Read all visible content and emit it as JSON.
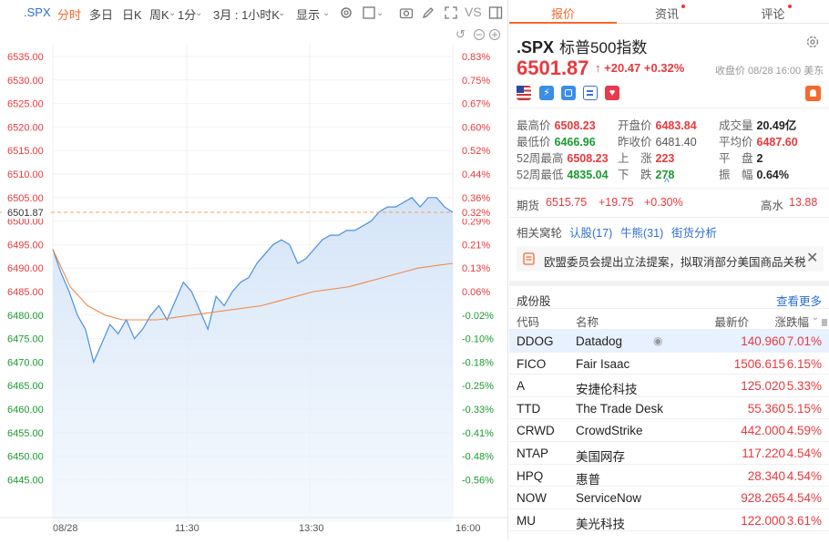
{
  "toolbar": {
    "ticker": ".SPX",
    "timeshare": "分时",
    "multiday": "多日",
    "dayk": "日K",
    "weekk": "周K",
    "minute": "1分",
    "period": "3月 : 1小时K",
    "display": "显示",
    "vs": "VS"
  },
  "chart_data": {
    "type": "line",
    "x_labels": [
      "08/28",
      "11:30",
      "13:30",
      "16:00"
    ],
    "y_left_ticks": [
      "6535.00",
      "6530.00",
      "6525.00",
      "6520.00",
      "6515.00",
      "6510.00",
      "6505.00",
      "6500.00",
      "6495.00",
      "6490.00",
      "6485.00",
      "6480.00",
      "6475.00",
      "6470.00",
      "6465.00",
      "6460.00",
      "6455.00",
      "6450.00",
      "6445.00"
    ],
    "y_right_ticks": [
      "0.83%",
      "0.75%",
      "0.67%",
      "0.60%",
      "0.52%",
      "0.44%",
      "0.36%",
      "0.29%",
      "0.21%",
      "0.13%",
      "0.06%",
      "-0.02%",
      "-0.10%",
      "-0.18%",
      "-0.25%",
      "-0.33%",
      "-0.41%",
      "-0.48%",
      "-0.56%"
    ],
    "ylim": [
      6445,
      6535
    ],
    "current_label_left": "6501.87",
    "current_label_right": "0.32%",
    "current_value": 6501.87,
    "price_series": [
      6494,
      6489,
      6485,
      6480,
      6477,
      6470,
      6474,
      6478,
      6476,
      6479,
      6475,
      6477,
      6480,
      6482,
      6479,
      6483,
      6487,
      6485,
      6481,
      6477,
      6484,
      6482,
      6485,
      6487,
      6488,
      6491,
      6493,
      6495,
      6496,
      6495,
      6491,
      6492,
      6494,
      6496,
      6497,
      6497,
      6498,
      6498,
      6499,
      6500,
      6502,
      6503,
      6503,
      6504,
      6505,
      6503,
      6505,
      6505,
      6503,
      6501.87
    ],
    "avg_series": [
      6494,
      6486,
      6482,
      6480,
      6479,
      6479,
      6479,
      6479.5,
      6480,
      6480.5,
      6481,
      6481.5,
      6482,
      6483,
      6484,
      6485,
      6485.5,
      6486,
      6487,
      6488,
      6489,
      6490,
      6490.5,
      6491
    ],
    "colors": {
      "price": "#4a90e2",
      "avg": "#f08b4a",
      "ref": "#f5a05a",
      "up": "#e8393d",
      "down": "#1a9b2e"
    }
  },
  "right": {
    "tabs": [
      "报价",
      "资讯",
      "评论"
    ],
    "symbol": ".SPX",
    "name": "标普500指数",
    "price": "6501.87",
    "change": "+20.47",
    "change_pct": "+0.32%",
    "close_time": "收盘价 08/28 16:00 美东",
    "stats": {
      "high_k": "最高价",
      "high_v": "6508.23",
      "open_k": "开盘价",
      "open_v": "6483.84",
      "vol_k": "成交量",
      "vol_v": "20.49亿",
      "low_k": "最低价",
      "low_v": "6466.96",
      "prev_k": "昨收价",
      "prev_v": "6481.40",
      "avg_k": "平均价",
      "avg_v": "6487.60",
      "wh_k": "52周最高",
      "wh_v": "6508.23",
      "up_k": "上　涨",
      "up_v": "223",
      "flat_k": "平　盘",
      "flat_v": "2",
      "wl_k": "52周最低",
      "wl_v": "4835.04",
      "down_k": "下　跌",
      "down_v": "278",
      "amp_k": "振　幅",
      "amp_v": "0.64%"
    },
    "futures": {
      "label": "期货",
      "value": "6515.75",
      "change": "+19.75",
      "pct": "+0.30%",
      "gaoshui_k": "高水",
      "gaoshui_v": "13.88"
    },
    "related": {
      "label": "相关窝轮",
      "call": "认股(17)",
      "bull": "牛熊(31)",
      "street": "街货分析"
    },
    "notice": "欧盟委员会提出立法提案，拟取消部分美国商品关税",
    "constituents_title": "成份股",
    "see_more": "查看更多",
    "table_headers": [
      "代码",
      "名称",
      "最新价",
      "涨跌幅"
    ],
    "rows": [
      {
        "code": "DDOG",
        "name": "Datadog",
        "price": "140.960",
        "pct": "7.01%"
      },
      {
        "code": "FICO",
        "name": "Fair Isaac",
        "price": "1506.615",
        "pct": "6.15%"
      },
      {
        "code": "A",
        "name": "安捷伦科技",
        "price": "125.020",
        "pct": "5.33%"
      },
      {
        "code": "TTD",
        "name": "The Trade Desk",
        "price": "55.360",
        "pct": "5.15%"
      },
      {
        "code": "CRWD",
        "name": "CrowdStrike",
        "price": "442.000",
        "pct": "4.59%"
      },
      {
        "code": "NTAP",
        "name": "美国网存",
        "price": "117.220",
        "pct": "4.54%"
      },
      {
        "code": "HPQ",
        "name": "惠普",
        "price": "28.340",
        "pct": "4.54%"
      },
      {
        "code": "NOW",
        "name": "ServiceNow",
        "price": "928.265",
        "pct": "4.54%"
      },
      {
        "code": "MU",
        "name": "美光科技",
        "price": "122.000",
        "pct": "3.61%"
      }
    ]
  }
}
